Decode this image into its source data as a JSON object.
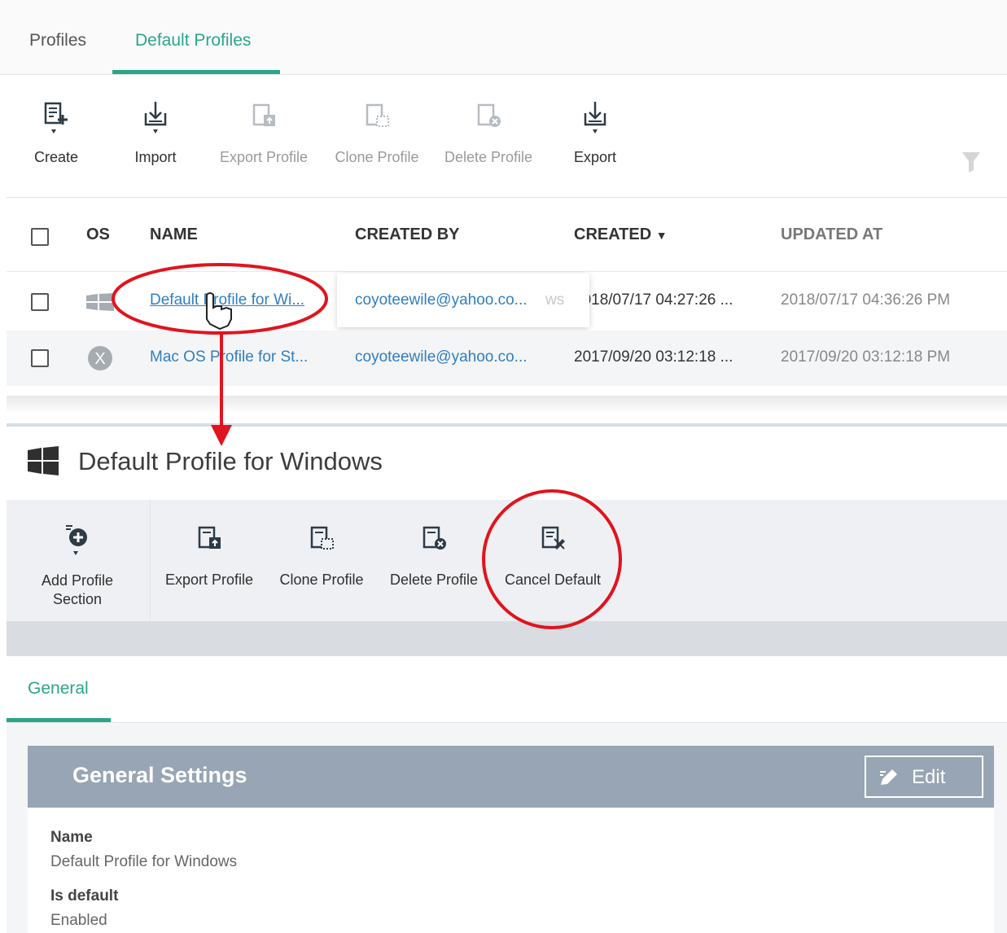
{
  "top_tabs": {
    "profiles": "Profiles",
    "default_profiles": "Default Profiles"
  },
  "toolbar": {
    "create": "Create",
    "import": "Import",
    "export_profile": "Export Profile",
    "clone_profile": "Clone Profile",
    "delete_profile": "Delete Profile",
    "export": "Export"
  },
  "table": {
    "headers": {
      "os": "OS",
      "name": "NAME",
      "created_by": "CREATED BY",
      "created": "CREATED",
      "updated_at": "UPDATED AT"
    },
    "sort_indicator": "▼",
    "rows": [
      {
        "os": "windows-icon",
        "name": "Default Profile for Wi...",
        "created_by": "coyoteewile@yahoo.co...",
        "created": "2018/07/17 04:27:26 ...",
        "updated_at": "2018/07/17 04:36:26 PM"
      },
      {
        "os": "mac-os-icon",
        "name": "Mac OS Profile for St...",
        "created_by": "coyoteewile@yahoo.co...",
        "created": "2017/09/20 03:12:18 ...",
        "updated_at": "2017/09/20 03:12:18 PM"
      }
    ],
    "tooltip_ghost": "ws"
  },
  "detail": {
    "title": "Default Profile for Windows",
    "toolbar": {
      "add_profile_section_line1": "Add Profile",
      "add_profile_section_line2": "Section",
      "export_profile": "Export Profile",
      "clone_profile": "Clone Profile",
      "delete_profile": "Delete Profile",
      "cancel_default": "Cancel Default"
    },
    "subtab": "General",
    "settings": {
      "title": "General Settings",
      "edit": "Edit",
      "fields": [
        {
          "label": "Name",
          "value": "Default Profile for Windows"
        },
        {
          "label": "Is default",
          "value": "Enabled"
        }
      ]
    }
  },
  "colors": {
    "accent": "#2aa689",
    "link": "#2f7fc1",
    "annotation": "#e0141e",
    "settings_header": "#97a5b4"
  }
}
